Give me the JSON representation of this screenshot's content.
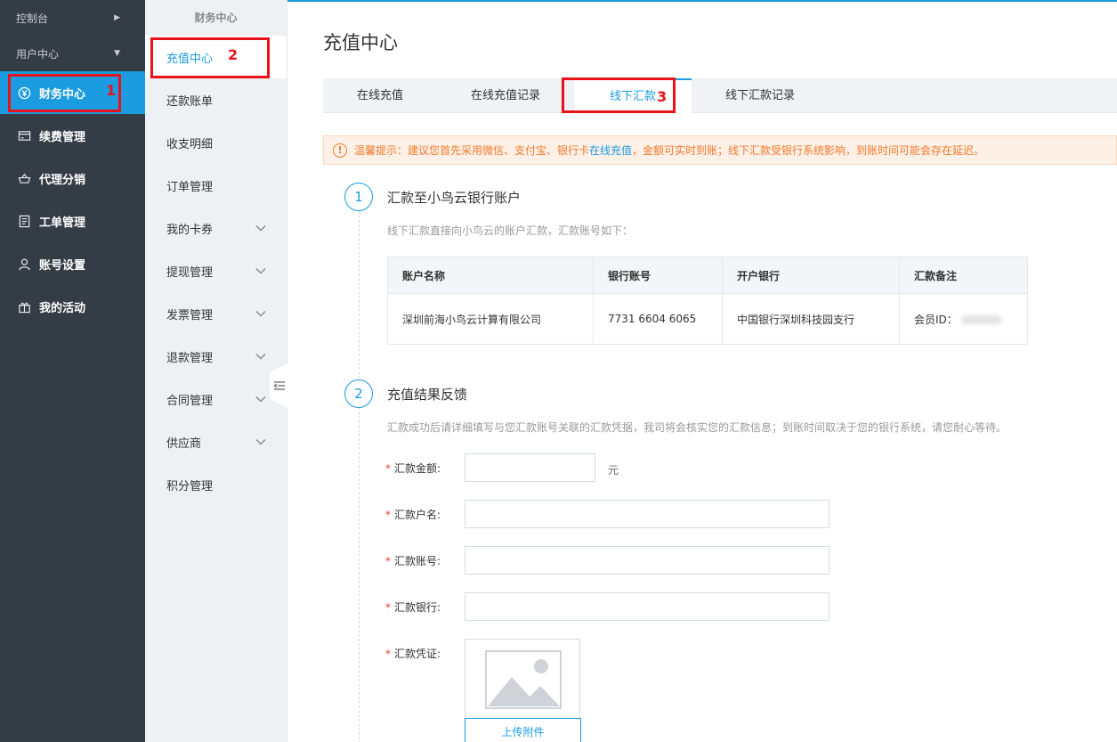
{
  "left_nav": {
    "top_items": [
      {
        "label": "控制台"
      },
      {
        "label": "用户中心"
      }
    ],
    "items": [
      {
        "label": "财务中心",
        "icon": "yen-icon"
      },
      {
        "label": "续费管理",
        "icon": "card-icon"
      },
      {
        "label": "代理分销",
        "icon": "basket-icon"
      },
      {
        "label": "工单管理",
        "icon": "ticket-icon"
      },
      {
        "label": "账号设置",
        "icon": "user-icon"
      },
      {
        "label": "我的活动",
        "icon": "gift-icon"
      }
    ]
  },
  "sub_nav": {
    "title": "财务中心",
    "items": [
      {
        "label": "充值中心"
      },
      {
        "label": "还款账单"
      },
      {
        "label": "收支明细"
      },
      {
        "label": "订单管理"
      },
      {
        "label": "我的卡券"
      },
      {
        "label": "提现管理"
      },
      {
        "label": "发票管理"
      },
      {
        "label": "退款管理"
      },
      {
        "label": "合同管理"
      },
      {
        "label": "供应商"
      },
      {
        "label": "积分管理"
      }
    ]
  },
  "main": {
    "title": "充值中心",
    "tabs": [
      {
        "label": "在线充值"
      },
      {
        "label": "在线充值记录"
      },
      {
        "label": "线下汇款"
      },
      {
        "label": "线下汇款记录"
      }
    ],
    "notice": {
      "before": "温馨提示：建议您首先采用微信、支付宝、银行卡",
      "link": "在线充值",
      "after": "，金额可实时到账；线下汇款受银行系统影响，到账时间可能会存在延迟。"
    },
    "step1": {
      "number": "1",
      "title": "汇款至小鸟云银行账户",
      "desc": "线下汇款直接向小鸟云的账户汇款，汇款账号如下：",
      "table": {
        "headers": [
          "账户名称",
          "银行账号",
          "开户银行",
          "汇款备注"
        ],
        "row": [
          "深圳前海小鸟云计算有限公司",
          "7731 6604 6065",
          "中国银行深圳科技园支行",
          "会员ID："
        ]
      }
    },
    "step2": {
      "number": "2",
      "title": "充值结果反馈",
      "desc": "汇款成功后请详细填写与您汇款账号关联的汇款凭据，我司将会核实您的汇款信息；到账时间取决于您的银行系统，请您耐心等待。",
      "form": {
        "amount_label": "汇款金额:",
        "amount_unit": "元",
        "name_label": "汇款户名:",
        "account_label": "汇款账号:",
        "bank_label": "汇款银行:",
        "voucher_label": "汇款凭证:",
        "upload_label": "上传附件"
      }
    },
    "annotations": {
      "marker1": "1",
      "marker2": "2",
      "marker3": "3"
    }
  },
  "colors": {
    "accent": "#1b9be0",
    "sidebar_bg": "#343c46",
    "warning": "#f2792b",
    "highlight_box": "#e8121b"
  }
}
